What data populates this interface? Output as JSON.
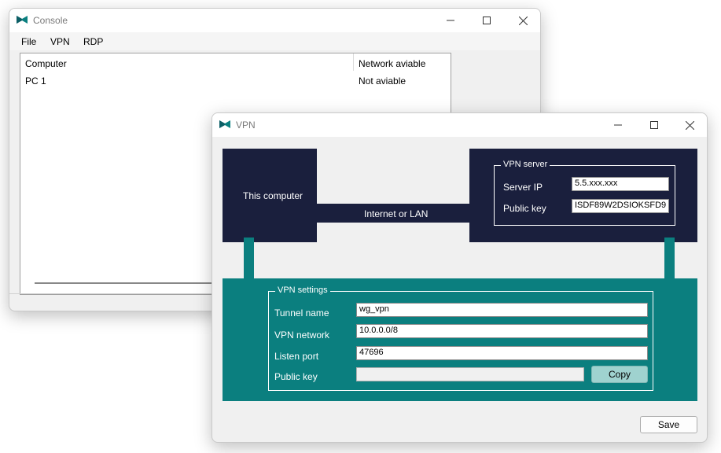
{
  "console": {
    "title": "Console",
    "menu": [
      "File",
      "VPN",
      "RDP"
    ],
    "columns": [
      "Computer",
      "Network aviable"
    ],
    "rows": [
      {
        "computer": "PC 1",
        "network": "Not aviable"
      }
    ]
  },
  "vpn": {
    "title": "VPN",
    "this_computer": "This computer",
    "link_label": "Internet or LAN",
    "server_group": {
      "legend": "VPN server",
      "server_ip_label": "Server IP",
      "server_ip_value": "5.5.xxx.xxx",
      "public_key_label": "Public key",
      "public_key_value": "ISDF89W2DSIOKSFD9"
    },
    "settings_group": {
      "legend": "VPN settings",
      "tunnel_name_label": "Tunnel name",
      "tunnel_name_value": "wg_vpn",
      "vpn_network_label": "VPN network",
      "vpn_network_value": "10.0.0.0/8",
      "listen_port_label": "Listen port",
      "listen_port_value": "47696",
      "public_key_label": "Public key",
      "public_key_value": "",
      "copy_label": "Copy"
    },
    "save_label": "Save"
  },
  "colors": {
    "dark_block": "#1a1f3d",
    "teal_block": "#0b7f7f",
    "logo": "#0b7f7f"
  },
  "icons": {
    "app_logo": "bowtie-logo-icon",
    "minimize": "minimize-icon",
    "maximize": "maximize-icon",
    "close": "close-icon"
  }
}
